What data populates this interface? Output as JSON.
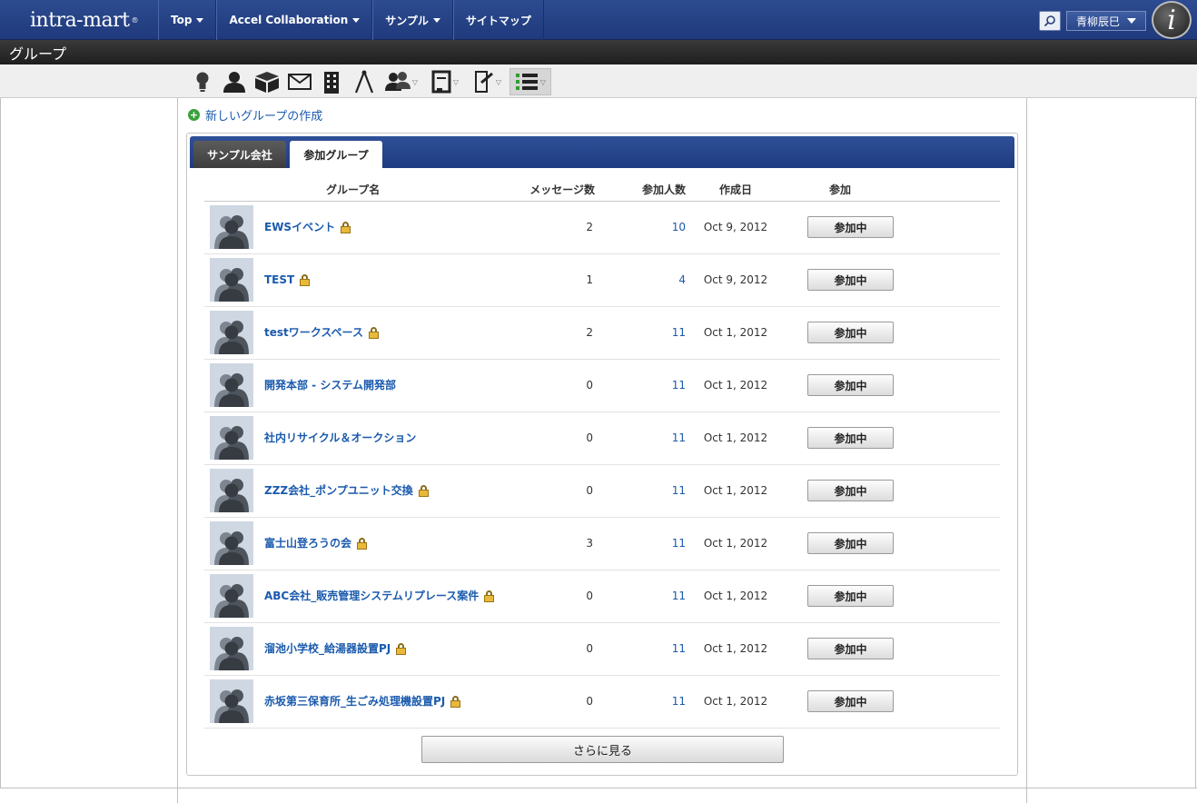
{
  "header": {
    "logo_text": "intra-mart",
    "nav": [
      {
        "label": "Top",
        "dropdown": true
      },
      {
        "label": "Accel Collaboration",
        "dropdown": true
      },
      {
        "label": "サンプル",
        "dropdown": true
      },
      {
        "label": "サイトマップ",
        "dropdown": false
      }
    ],
    "user_name": "青柳辰巳",
    "brand_icon": "i"
  },
  "page_title": "グループ",
  "toolbar_icons": [
    "lightbulb-icon",
    "person-icon",
    "box-icon",
    "mail-icon",
    "building-icon",
    "compass-icon",
    "group-icon",
    "board-icon",
    "form-icon",
    "list-icon"
  ],
  "new_group_label": "新しいグループの作成",
  "tabs": [
    {
      "label": "サンプル会社",
      "active": false
    },
    {
      "label": "参加グループ",
      "active": true
    }
  ],
  "table": {
    "columns": {
      "name": "グループ名",
      "messages": "メッセージ数",
      "members": "参加人数",
      "created": "作成日",
      "join": "参加"
    },
    "rows": [
      {
        "name": "EWSイベント",
        "locked": true,
        "messages": "2",
        "members": "10",
        "created": "Oct 9, 2012",
        "status": "参加中"
      },
      {
        "name": "TEST",
        "locked": true,
        "messages": "1",
        "members": "4",
        "created": "Oct 9, 2012",
        "status": "参加中"
      },
      {
        "name": "testワークスペース",
        "locked": true,
        "messages": "2",
        "members": "11",
        "created": "Oct 1, 2012",
        "status": "参加中"
      },
      {
        "name": "開発本部 - システム開発部",
        "locked": false,
        "messages": "0",
        "members": "11",
        "created": "Oct 1, 2012",
        "status": "参加中"
      },
      {
        "name": "社内リサイクル＆オークション",
        "locked": false,
        "messages": "0",
        "members": "11",
        "created": "Oct 1, 2012",
        "status": "参加中"
      },
      {
        "name": "ZZZ会社_ポンプユニット交換",
        "locked": true,
        "messages": "0",
        "members": "11",
        "created": "Oct 1, 2012",
        "status": "参加中"
      },
      {
        "name": "富士山登ろうの会",
        "locked": true,
        "messages": "3",
        "members": "11",
        "created": "Oct 1, 2012",
        "status": "参加中"
      },
      {
        "name": "ABC会社_販売管理システムリプレース案件",
        "locked": true,
        "messages": "0",
        "members": "11",
        "created": "Oct 1, 2012",
        "status": "参加中"
      },
      {
        "name": "溜池小学校_給湯器設置PJ",
        "locked": true,
        "messages": "0",
        "members": "11",
        "created": "Oct 1, 2012",
        "status": "参加中"
      },
      {
        "name": "赤坂第三保育所_生ごみ処理機設置PJ",
        "locked": true,
        "messages": "0",
        "members": "11",
        "created": "Oct 1, 2012",
        "status": "参加中"
      }
    ]
  },
  "more_label": "さらに見る"
}
